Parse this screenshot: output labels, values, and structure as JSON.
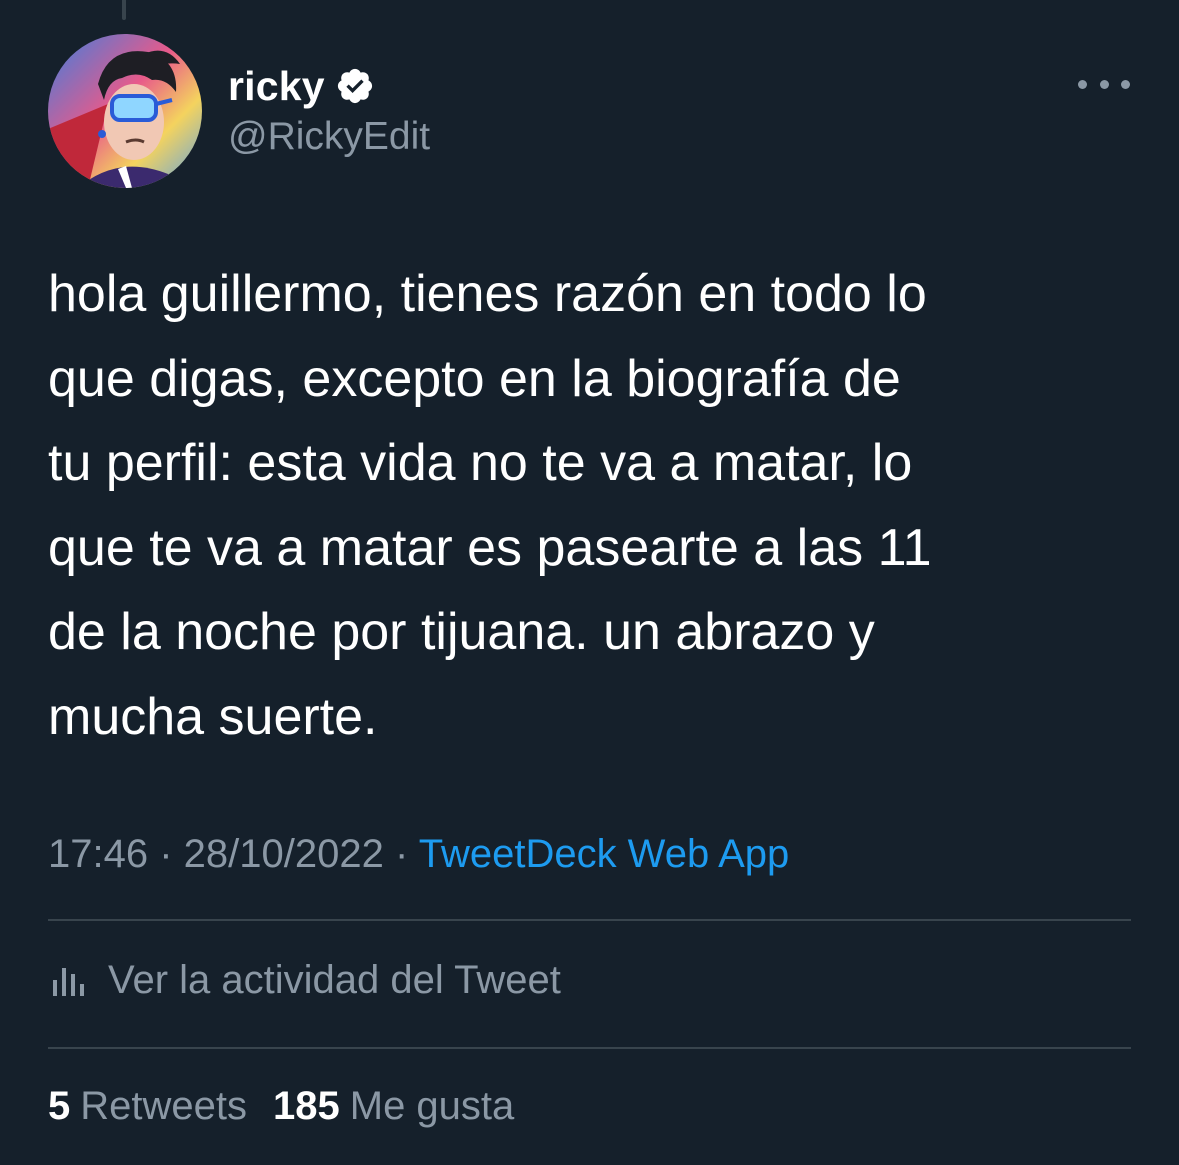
{
  "author": {
    "display_name": "ricky",
    "handle": "@RickyEdit",
    "verified": true,
    "avatar_icon": "cartoon-avatar"
  },
  "tweet": {
    "text": "hola guillermo, tienes razón en todo lo\nque digas, excepto en la biografía de\ntu perfil: esta vida no te va a matar, lo\nque te va a matar es pasearte a las 11\nde la noche por tijuana. un abrazo y\nmucha suerte.",
    "time": "17:46",
    "date": "28/10/2022",
    "separator": "·",
    "source": "TweetDeck Web App"
  },
  "activity": {
    "label": "Ver la actividad del Tweet",
    "icon": "bar-chart-icon"
  },
  "stats": {
    "retweets_count": "5",
    "retweets_label": "Retweets",
    "likes_count": "185",
    "likes_label": "Me gusta"
  },
  "colors": {
    "background": "#15202b",
    "text_primary": "#ffffff",
    "text_secondary": "#8b98a5",
    "accent": "#1d9bf0",
    "divider": "#38444d"
  }
}
